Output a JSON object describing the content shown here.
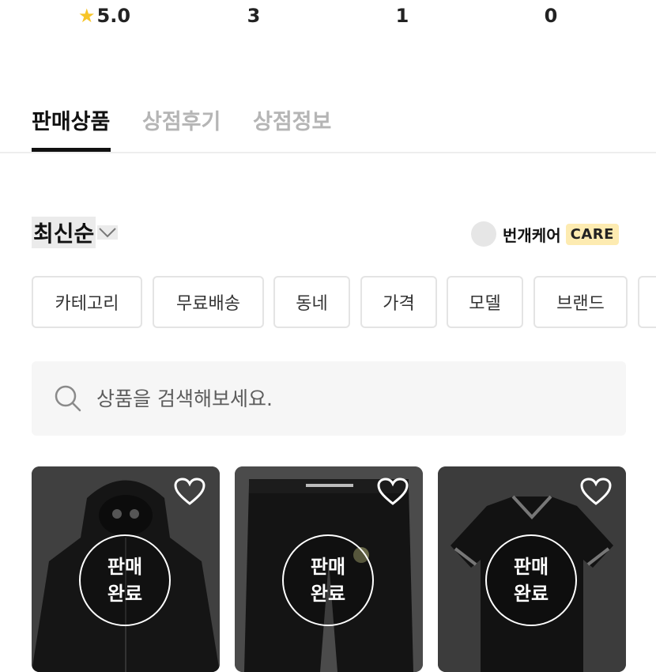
{
  "stats": {
    "rating": "5.0",
    "stat2": "3",
    "stat3": "1",
    "stat4": "0"
  },
  "tabs": [
    {
      "label": "판매상품",
      "active": true
    },
    {
      "label": "상점후기",
      "active": false
    },
    {
      "label": "상점정보",
      "active": false
    }
  ],
  "sort": {
    "label": "최신순"
  },
  "care": {
    "label": "번개케어",
    "badge": "CARE"
  },
  "filters": [
    {
      "label": "카테고리"
    },
    {
      "label": "무료배송"
    },
    {
      "label": "동네"
    },
    {
      "label": "가격"
    },
    {
      "label": "모델"
    },
    {
      "label": "브랜드"
    }
  ],
  "search": {
    "placeholder": "상품을 검색해보세요."
  },
  "products": [
    {
      "status_line1": "판매",
      "status_line2": "완료"
    },
    {
      "status_line1": "판매",
      "status_line2": "완료"
    },
    {
      "status_line1": "판매",
      "status_line2": "완료"
    }
  ],
  "colors": {
    "accent_star": "#f7c528",
    "care_badge_bg": "#fdebb1",
    "active_tab": "#111111",
    "inactive_tab": "#b5b5b5"
  },
  "icons": [
    "star-icon",
    "chevron-down-icon",
    "search-icon",
    "heart-icon"
  ]
}
